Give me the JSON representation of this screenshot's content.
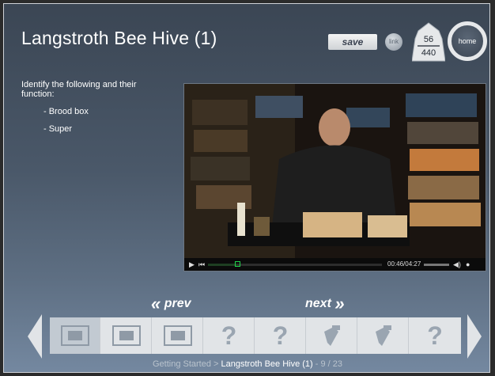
{
  "header": {
    "title": "Langstroth Bee Hive (1)",
    "save_label": "save",
    "link_label": "link",
    "counter_top": "56",
    "counter_bottom": "440",
    "home_label": "home"
  },
  "instructions": {
    "prompt": "Identify the following and their function:",
    "items": [
      "- Brood box",
      "- Super"
    ]
  },
  "video": {
    "timecode": "00:46/04:27",
    "progress": 0.17
  },
  "nav": {
    "prev_label": "prev",
    "next_label": "next"
  },
  "thumbnails": [
    {
      "kind": "video",
      "active": true
    },
    {
      "kind": "video",
      "active": false
    },
    {
      "kind": "video",
      "active": false
    },
    {
      "kind": "question",
      "label": "?"
    },
    {
      "kind": "question",
      "label": "?"
    },
    {
      "kind": "tool",
      "active": false
    },
    {
      "kind": "tool",
      "active": false
    },
    {
      "kind": "question",
      "label": "?"
    }
  ],
  "breadcrumb": {
    "section": "Getting Started",
    "separator": ">",
    "current": "Langstroth Bee Hive (1)",
    "position": "- 9 / 23"
  }
}
